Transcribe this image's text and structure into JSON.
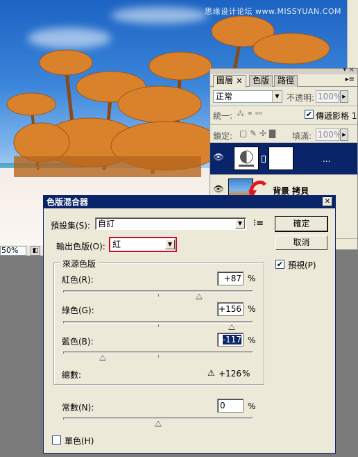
{
  "watermark": "思缘设计论坛 www.MISSYUAN.COM",
  "document": {
    "zoom": "50%"
  },
  "layers_panel": {
    "tabs": [
      {
        "label": "圖層",
        "close": "×"
      },
      {
        "label": "色版"
      },
      {
        "label": "路徑"
      }
    ],
    "blend_mode": "正常",
    "opacity_label": "不透明:",
    "opacity_value": "100%",
    "unify_label": "統一:",
    "propagate_label": "傳遞影格 1",
    "lock_label": "鎖定:",
    "fill_label": "填滿:",
    "fill_value": "100%",
    "layers": [
      {
        "name": "...",
        "selected": true
      },
      {
        "name": "背景 拷貝",
        "selected": false
      }
    ]
  },
  "dialog": {
    "title": "色版混合器",
    "preset_label": "預設集(S):",
    "preset_value": "自訂",
    "output_label": "輸出色版(O):",
    "output_value": "紅",
    "ok_label": "確定",
    "cancel_label": "取消",
    "preview_label": "預視(P)",
    "preview_checked": true,
    "source_group_label": "來源色版",
    "channels": [
      {
        "label": "紅色(R):",
        "value": "+87",
        "unit": "%",
        "slider_percent": 87
      },
      {
        "label": "綠色(G):",
        "value": "+156",
        "unit": "%",
        "slider_percent": 156
      },
      {
        "label": "藍色(B):",
        "value": "-117",
        "unit": "%",
        "slider_percent": -117
      }
    ],
    "total_label": "總數:",
    "total_value": "+126",
    "total_unit": "%",
    "constant_label": "常數(N):",
    "constant_value": "0",
    "constant_unit": "%",
    "constant_slider_percent": 0,
    "monochrome_label": "單色(H)",
    "monochrome_checked": false
  }
}
